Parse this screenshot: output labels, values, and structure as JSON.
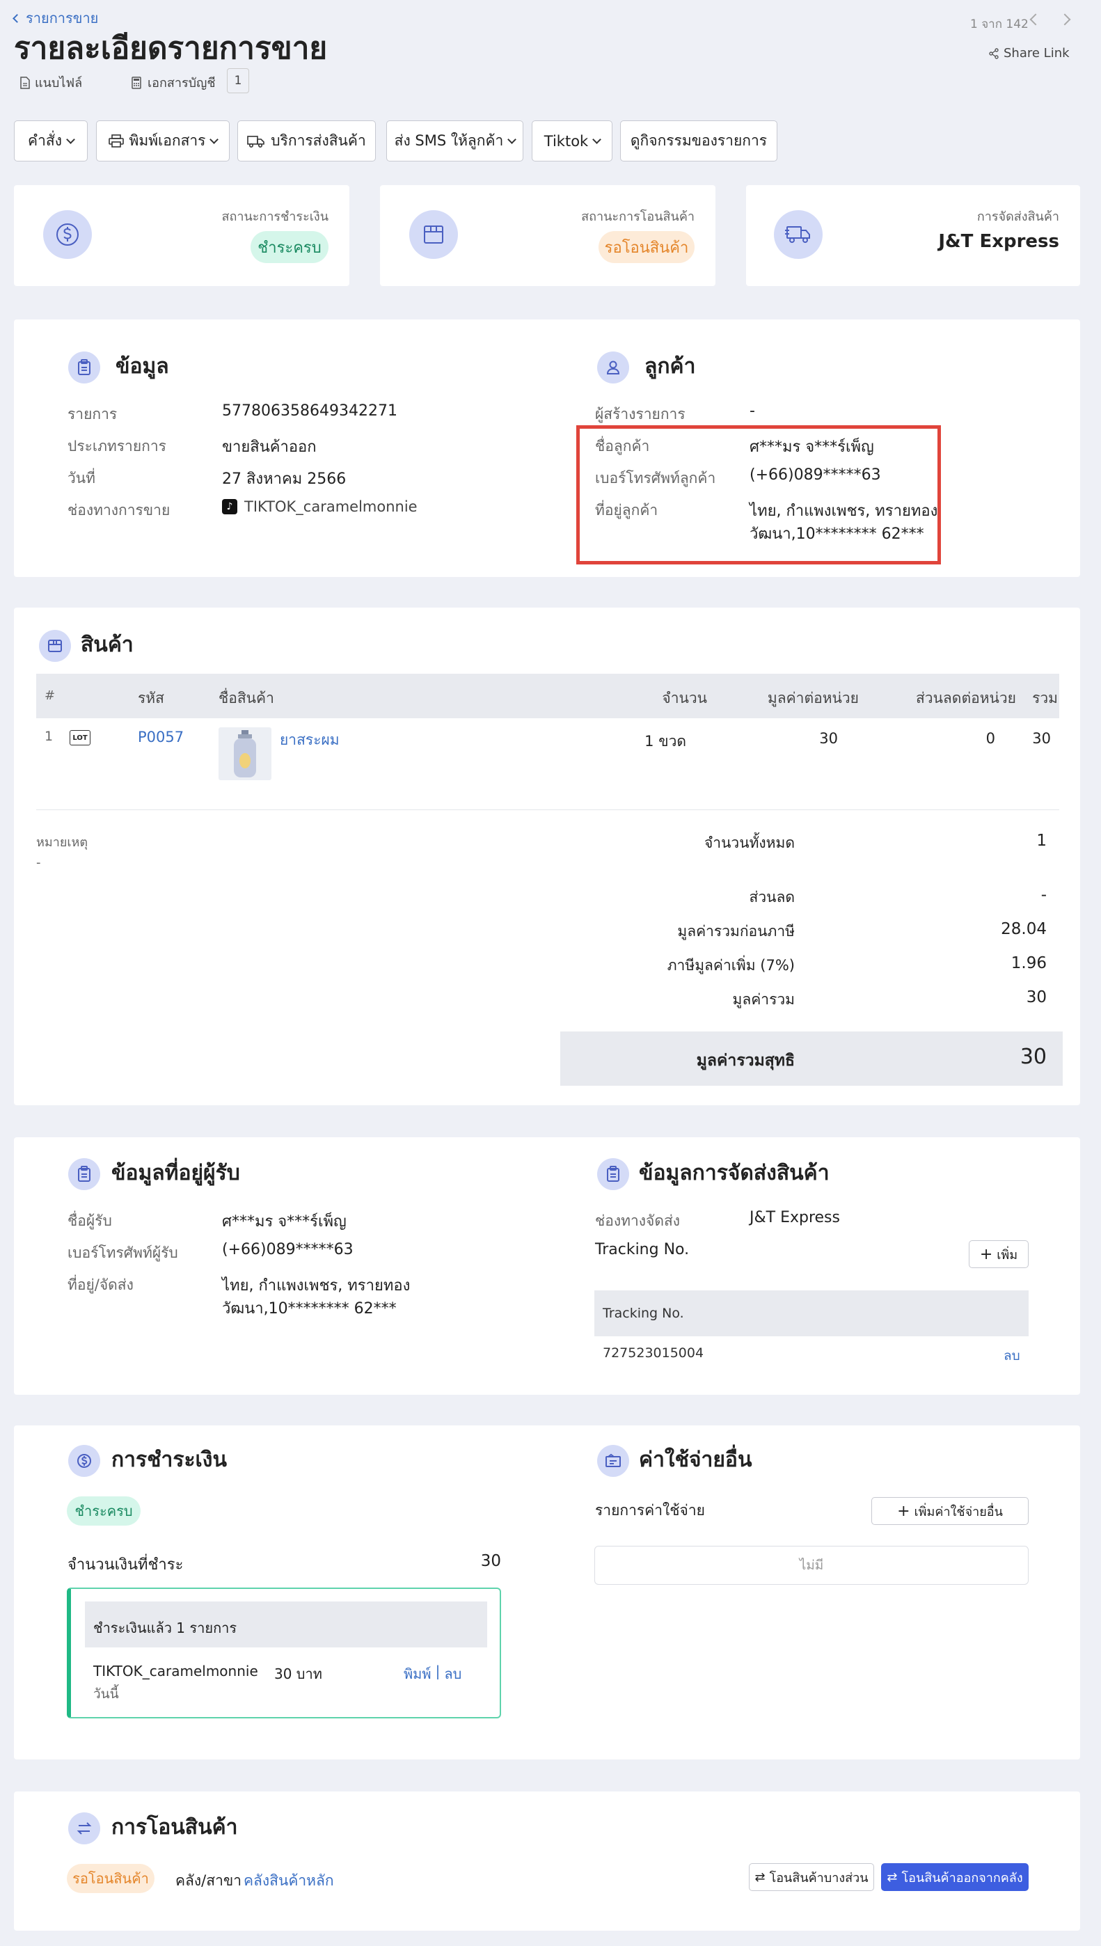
{
  "header": {
    "back_link": "รายการขาย",
    "title": "รายละเอียดรายการขาย",
    "attach_label": "แนบไฟล์",
    "docs_label": "เอกสารบัญชี",
    "docs_count": "1",
    "pager": "1 จาก 142",
    "share_label": "Share Link"
  },
  "toolbar": {
    "command": "คำสั่ง",
    "print": "พิมพ์เอกสาร",
    "shipping_service": "บริการส่งสินค้า",
    "sms": "ส่ง SMS ให้ลูกค้า",
    "tiktok": "Tiktok",
    "activity": "ดูกิจกรรมของรายการ"
  },
  "status_cards": {
    "payment": {
      "label": "สถานะการชำระเงิน",
      "value": "ชำระครบ"
    },
    "transfer": {
      "label": "สถานะการโอนสินค้า",
      "value": "รอโอนสินค้า"
    },
    "shipping": {
      "label": "การจัดส่งสินค้า",
      "value": "J&T Express"
    }
  },
  "info": {
    "title": "ข้อมูล",
    "rows": [
      {
        "label": "รายการ",
        "value": "577806358649342271"
      },
      {
        "label": "ประเภทรายการ",
        "value": "ขายสินค้าออก"
      },
      {
        "label": "วันที่",
        "value": "27 สิงหาคม 2566"
      },
      {
        "label": "ช่องทางการขาย",
        "value": "TIKTOK_caramelmonnie"
      }
    ]
  },
  "customer": {
    "title": "ลูกค้า",
    "creator_label": "ผู้สร้างรายการ",
    "creator_value": "-",
    "name_label": "ชื่อลูกค้า",
    "name_value": "ศ***มร จ***ร์เพ็ญ",
    "phone_label": "เบอร์โทรศัพท์ลูกค้า",
    "phone_value": "(+66)089*****63",
    "address_label": "ที่อยู่ลูกค้า",
    "address_line1": "ไทย, กำแพงเพชร, ทรายทอง",
    "address_line2": "วัฒนา,10******** 62***"
  },
  "products": {
    "title": "สินค้า",
    "columns": [
      "#",
      "รหัส",
      "ชื่อสินค้า",
      "จำนวน",
      "มูลค่าต่อหน่วย",
      "ส่วนลดต่อหน่วย",
      "รวม"
    ],
    "rows": [
      {
        "index": "1",
        "lot": "LOT",
        "code": "P0057",
        "name": "ยาสระผม",
        "qty": "1 ขวด",
        "unit_price": "30",
        "discount": "0",
        "total": "30"
      }
    ],
    "note_label": "หมายเหตุ",
    "note_value": "-"
  },
  "summary": {
    "total_qty_label": "จำนวนทั้งหมด",
    "total_qty": "1",
    "discount_label": "ส่วนลด",
    "discount": "-",
    "pre_tax_label": "มูลค่ารวมก่อนภาษี",
    "pre_tax": "28.04",
    "vat_label": "ภาษีมูลค่าเพิ่ม (7%)",
    "vat": "1.96",
    "total_label": "มูลค่ารวม",
    "total": "30",
    "net_label": "มูลค่ารวมสุทธิ",
    "net": "30"
  },
  "recipient": {
    "title": "ข้อมูลที่อยู่ผู้รับ",
    "name_label": "ชื่อผู้รับ",
    "name_value": "ศ***มร จ***ร์เพ็ญ",
    "phone_label": "เบอร์โทรศัพท์ผู้รับ",
    "phone_value": "(+66)089*****63",
    "address_label": "ที่อยู่/จัดส่ง",
    "address_line1": "ไทย, กำแพงเพชร, ทรายทอง",
    "address_line2": "วัฒนา,10******** 62***"
  },
  "delivery": {
    "title": "ข้อมูลการจัดส่งสินค้า",
    "channel_label": "ช่องทางจัดส่ง",
    "channel_value": "J&T Express",
    "tracking_label": "Tracking No.",
    "add_button": "เพิ่ม",
    "table_header": "Tracking No.",
    "tracking_number": "727523015004",
    "delete_link": "ลบ"
  },
  "payment": {
    "title": "การชำระเงิน",
    "status": "ชำระครบ",
    "amount_label": "จำนวนเงินที่ชำระ",
    "amount": "30",
    "box_header": "ชำระเงินแล้ว 1 รายการ",
    "entry_channel": "TIKTOK_caramelmonnie",
    "entry_amount": "30 บาท",
    "entry_date": "วันนี้",
    "print_link": "พิมพ์",
    "separator": "|",
    "delete_link": "ลบ"
  },
  "expenses": {
    "title": "ค่าใช้จ่ายอื่น",
    "list_label": "รายการค่าใช้จ่าย",
    "add_button": "เพิ่มค่าใช้จ่ายอื่น",
    "empty": "ไม่มี"
  },
  "transfer": {
    "title": "การโอนสินค้า",
    "status": "รอโอนสินค้า",
    "warehouse_label": "คลัง/สาขา",
    "warehouse_value": "คลังสินค้าหลัก",
    "partial_button": "โอนสินค้าบางส่วน",
    "out_button": "โอนสินค้าออกจากคลัง"
  },
  "colors": {
    "accent": "#3d5ee0",
    "highlight_border": "#e0443b",
    "green_badge": "#d5f6ea",
    "orange_badge": "#fdebd8"
  }
}
